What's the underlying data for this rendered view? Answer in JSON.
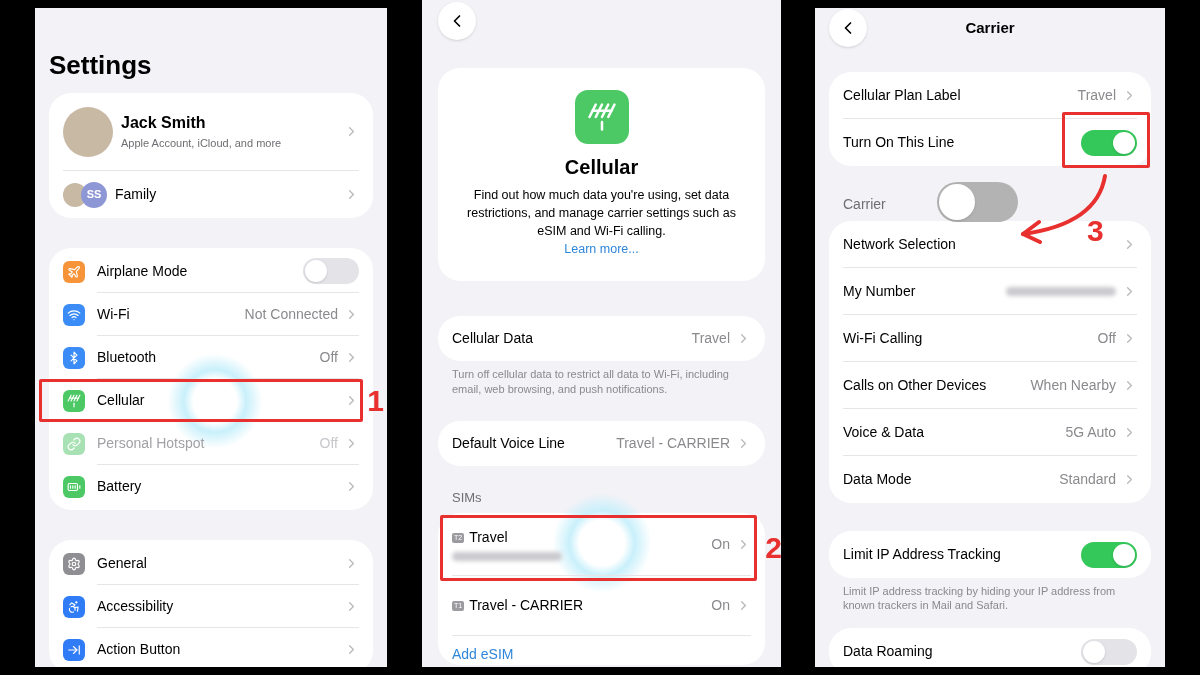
{
  "settings_screen": {
    "title": "Settings",
    "account": {
      "name": "Jack Smith",
      "subtitle": "Apple Account, iCloud, and more"
    },
    "family": {
      "initials": "SS",
      "label": "Family"
    },
    "groups": [
      [
        {
          "kind": "toggle",
          "label": "Airplane Mode",
          "on": false,
          "disabled": false,
          "color": "#f7943a"
        },
        {
          "kind": "link",
          "label": "Wi-Fi",
          "value": "Not Connected",
          "disabled": false,
          "color": "#3b8cf6"
        },
        {
          "kind": "link",
          "label": "Bluetooth",
          "value": "Off",
          "disabled": false,
          "color": "#3b8cf6"
        },
        {
          "kind": "link",
          "label": "Cellular",
          "disabled": false,
          "color": "#4cc964",
          "step": "1"
        },
        {
          "kind": "link",
          "label": "Personal Hotspot",
          "value": "Off",
          "disabled": true,
          "color": "#a8e2b4"
        },
        {
          "kind": "link",
          "label": "Battery",
          "disabled": false,
          "color": "#4cc964"
        }
      ],
      [
        {
          "kind": "link",
          "label": "General",
          "disabled": false,
          "color": "#8e8e93"
        },
        {
          "kind": "link",
          "label": "Accessibility",
          "disabled": false,
          "color": "#2f7cf6"
        },
        {
          "kind": "link",
          "label": "Action Button",
          "disabled": false,
          "color": "#2f7cf6"
        }
      ]
    ]
  },
  "cellular_screen": {
    "title": "Cellular",
    "description": "Find out how much data you're using, set data restrictions, and manage carrier settings such as eSIM and Wi-Fi calling.",
    "learn_more": "Learn more...",
    "cellular_data": {
      "label": "Cellular Data",
      "value": "Travel"
    },
    "cellular_data_footer": "Turn off cellular data to restrict all data to Wi-Fi, including email, web browsing, and push notifications.",
    "default_voice_line": {
      "label": "Default Voice Line",
      "value": "Travel - CARRIER"
    },
    "sims_header": "SIMs",
    "sims": [
      {
        "badge": "T2",
        "name": "Travel",
        "number_masked": true,
        "value": "On",
        "step": "2"
      },
      {
        "badge": "T1",
        "name": "Travel - CARRIER",
        "number_masked": false,
        "value": "On"
      }
    ],
    "add_esim": "Add eSIM"
  },
  "carrier_screen": {
    "title": "Carrier",
    "plan_group": [
      {
        "kind": "link",
        "label": "Cellular Plan Label",
        "value": "Travel"
      },
      {
        "kind": "toggle",
        "label": "Turn On This Line",
        "on": true,
        "step": "3"
      }
    ],
    "carrier_header": "Carrier",
    "overlay_toggle": {
      "on": false
    },
    "carrier_group": [
      {
        "kind": "link",
        "label": "Network Selection"
      },
      {
        "kind": "masked",
        "label": "My Number"
      },
      {
        "kind": "link",
        "label": "Wi-Fi Calling",
        "value": "Off"
      },
      {
        "kind": "link",
        "label": "Calls on Other Devices",
        "value": "When Nearby"
      },
      {
        "kind": "link",
        "label": "Voice & Data",
        "value": "5G Auto"
      },
      {
        "kind": "link",
        "label": "Data Mode",
        "value": "Standard"
      }
    ],
    "limit_ip": {
      "kind": "toggle",
      "label": "Limit IP Address Tracking",
      "on": true
    },
    "limit_ip_footer": "Limit IP address tracking by hiding your IP address from known trackers in Mail and Safari.",
    "data_roaming": {
      "kind": "toggle",
      "label": "Data Roaming",
      "on": false
    }
  }
}
